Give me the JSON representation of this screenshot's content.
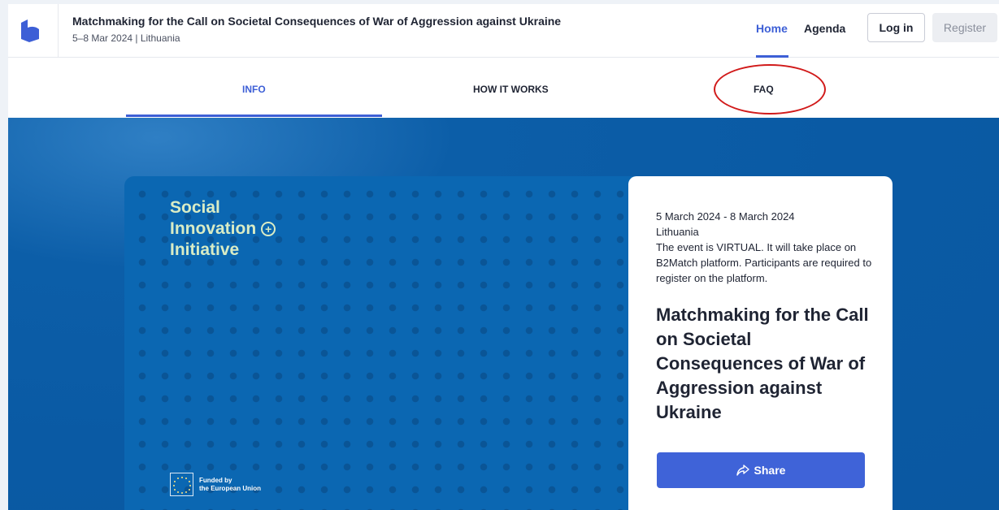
{
  "header": {
    "event_title": "Matchmaking for the Call on Societal Consequences of War of Aggression against Ukraine",
    "event_subtitle": "5–8 Mar 2024 | Lithuania",
    "nav": {
      "home": "Home",
      "agenda": "Agenda"
    },
    "login_label": "Log in",
    "register_label": "Register",
    "logo_icon": "b2match-logo-icon"
  },
  "tabs": [
    {
      "label": "INFO",
      "active": true
    },
    {
      "label": "HOW IT WORKS",
      "active": false
    },
    {
      "label": "FAQ",
      "active": false
    }
  ],
  "annotation": {
    "shape": "ellipse",
    "color": "#d11a1a",
    "target": "FAQ"
  },
  "hero": {
    "visual": {
      "title_lines": [
        "Social",
        "Innovation",
        "Initiative"
      ],
      "plus_glyph": "+",
      "funding_line1": "Funded by",
      "funding_line2": "the European Union",
      "flag_icon": "eu-flag-icon"
    },
    "card": {
      "dates": "5 March 2024 - 8 March 2024",
      "location": "Lithuania",
      "description": "The event is VIRTUAL. It will take place on B2Match platform. Participants are required to register on the platform.",
      "title": "Matchmaking for the Call on Societal Consequences of War of Aggression against Ukraine",
      "share_label": "Share",
      "share_icon": "share-arrow-icon"
    }
  },
  "colors": {
    "accent": "#3d5fd6",
    "hero_blue": "#0a5aa4",
    "visual_text": "#d9ecc5",
    "annotation_red": "#d11a1a"
  }
}
